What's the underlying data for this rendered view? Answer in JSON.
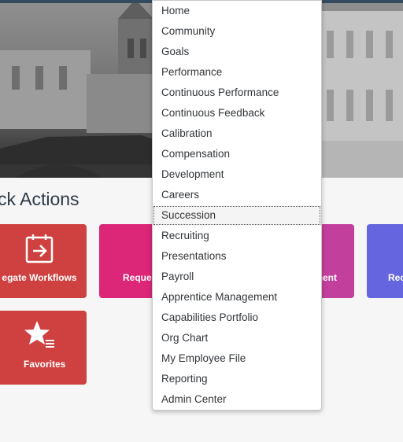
{
  "quick_actions": {
    "title": "ck Actions",
    "tiles": [
      {
        "label": "egate Workflows",
        "icon": "calendar-arrow-icon",
        "color": "#cf4140"
      },
      {
        "label": "Reques",
        "icon": "arrow-icon",
        "color": "#dc2677"
      },
      {
        "label": "ment",
        "icon": "",
        "color": "#c2409c"
      },
      {
        "label": "Rec",
        "icon": "",
        "color": "#6565e0"
      },
      {
        "label": "Favorites",
        "icon": "star-list-icon",
        "color": "#cf4140"
      }
    ]
  },
  "nav_menu": {
    "items": [
      "Home",
      "Community",
      "Goals",
      "Performance",
      "Continuous Performance",
      "Continuous Feedback",
      "Calibration",
      "Compensation",
      "Development",
      "Careers",
      "Succession",
      "Recruiting",
      "Presentations",
      "Payroll",
      "Apprentice Management",
      "Capabilities Portfolio",
      "Org Chart",
      "My Employee File",
      "Reporting",
      "Admin Center"
    ],
    "active": "Succession"
  },
  "colors": {
    "header": "#354a5f",
    "page_bg": "#f6f6f6",
    "tile_red": "#cf4140",
    "tile_pink": "#dc2677",
    "tile_magenta": "#c2409c",
    "tile_purple": "#6565e0"
  }
}
